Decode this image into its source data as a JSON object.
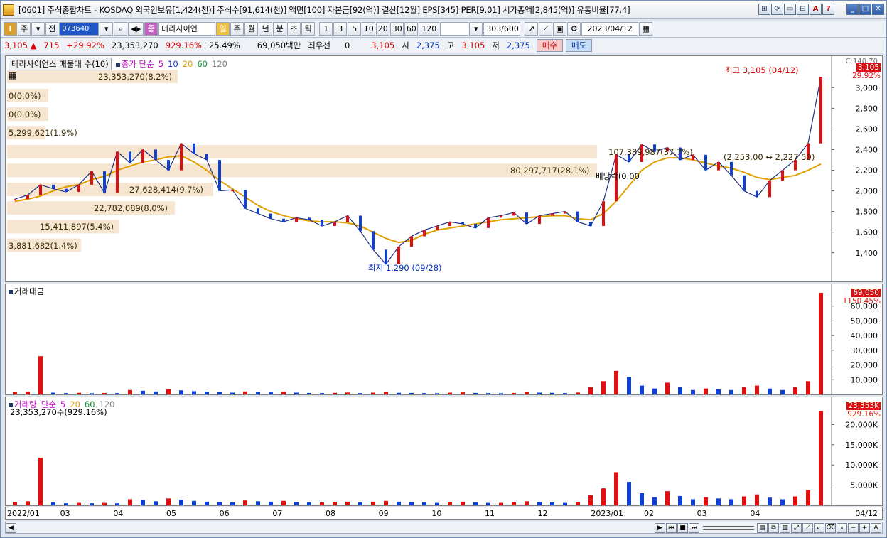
{
  "window": {
    "title": "[0601] 주식종합차트 - KOSDAQ 외국인보유[1,424(천)] 주식수[91,614(천)] 액면[100] 자본금[92(억)] 결산[12월] EPS[345] PER[9.01] 시가총액[2,845(억)] 유통비율[77.4]",
    "controls": [
      "⊞",
      "⟳",
      "▭",
      "⊟",
      "A",
      "?",
      "_",
      "□",
      "✕"
    ]
  },
  "toolbar": {
    "type_select": "주",
    "prev_label": "전",
    "stock_code": "073640",
    "stock_name": "테라사이언",
    "periods": [
      "일",
      "주",
      "월",
      "년",
      "분",
      "초",
      "틱"
    ],
    "active_period": "일",
    "intervals": [
      "1",
      "3",
      "5",
      "10",
      "20",
      "30",
      "60",
      "120"
    ],
    "page_display": "303/600",
    "date": "2023/04/12"
  },
  "quote": {
    "price": "3,105",
    "change": "715",
    "change_pct": "+29.92%",
    "volume": "23,353,270",
    "volume_pct": "929.16%",
    "turnover": "25.49%",
    "amount": "69,050백만",
    "pref_label": "최우선",
    "pref_value": "0",
    "ask": "3,105",
    "open_label": "시",
    "open": "2,375",
    "high_label": "고",
    "high": "3,105",
    "low_label": "저",
    "low": "2,375",
    "buy_label": "매수",
    "sell_label": "매도"
  },
  "price_panel": {
    "legend_box": "테라사이언스 매물대 수(10)",
    "ma_label": "종가 단순",
    "ma_periods": [
      "5",
      "10",
      "20",
      "60",
      "120"
    ],
    "ma_colors": [
      "#c000c0",
      "#1030c0",
      "#e0a000",
      "#109030",
      "#808080"
    ],
    "high_note": "최고 3,105 (04/12)",
    "low_note": "최저 1,290 (09/28)",
    "dividend_note": "배당락(0.00",
    "axis_top": "C:140.70",
    "last_tag": "3,105",
    "last_pct": "29.92%",
    "bands": [
      {
        "label": "23,353,270(8.2%)",
        "price": 3105
      },
      {
        "label": "0(0.0%)",
        "price": 2920
      },
      {
        "label": "0(0.0%)",
        "price": 2740
      },
      {
        "label": "5,299,621(1.9%)",
        "price": 2560
      },
      {
        "label": "107,389,987(37.7%)",
        "price": 2375
      },
      {
        "label": "80,297,717(28.1%)",
        "price": 2195
      },
      {
        "label": "27,628,414(9.7%)",
        "price": 2010
      },
      {
        "label": "22,782,089(8.0%)",
        "price": 1830
      },
      {
        "label": "15,411,897(5.4%)",
        "price": 1650
      },
      {
        "label": "3,881,682(1.4%)",
        "price": 1470
      }
    ],
    "cursor_note": "(2,253.00 ↔ 2,227.50)"
  },
  "amount_panel": {
    "title": "거래대금",
    "last_tag": "69,050",
    "last_pct": "1150.45%"
  },
  "volume_panel": {
    "title": "거래량",
    "ma_label": "단순",
    "ma_periods": [
      "5",
      "20",
      "60",
      "120"
    ],
    "ma_colors": [
      "#c000c0",
      "#e0a000",
      "#109030",
      "#808080"
    ],
    "last_value": "23,353,270주(929.16%)",
    "last_tag": "23,353K",
    "last_pct": "929.16%"
  },
  "xaxis": {
    "labels": [
      "2022/01",
      "03",
      "04",
      "05",
      "06",
      "07",
      "08",
      "09",
      "10",
      "11",
      "12",
      "2023/01",
      "02",
      "03",
      "04"
    ],
    "right_label": "04/12"
  },
  "chart_data": [
    {
      "type": "line",
      "name": "price",
      "ylim": [
        1240,
        3250
      ],
      "yticks": [
        1400,
        1600,
        1800,
        2000,
        2200,
        2400,
        2600,
        2800,
        3000
      ],
      "x": [
        "2022/01",
        "03",
        "04",
        "05",
        "06",
        "07",
        "08",
        "09",
        "10",
        "11",
        "12",
        "2023/01",
        "02",
        "03",
        "04"
      ],
      "close_path": [
        1920,
        1960,
        2060,
        2020,
        1990,
        2060,
        2190,
        1980,
        2380,
        2270,
        2400,
        2300,
        2200,
        2460,
        2360,
        2300,
        2000,
        2010,
        1830,
        1780,
        1730,
        1700,
        1740,
        1720,
        1660,
        1700,
        1760,
        1610,
        1430,
        1290,
        1460,
        1560,
        1620,
        1660,
        1700,
        1680,
        1640,
        1740,
        1760,
        1790,
        1680,
        1760,
        1780,
        1800,
        1700,
        1660,
        1900,
        2350,
        2280,
        2450,
        2380,
        2420,
        2300,
        2350,
        2200,
        2280,
        2150,
        2000,
        1940,
        2100,
        2200,
        2300,
        2460,
        3105
      ],
      "ma_period": "20",
      "ma_values": [
        1900,
        1920,
        1950,
        2000,
        2040,
        2060,
        2110,
        2140,
        2200,
        2240,
        2280,
        2300,
        2330,
        2340,
        2280,
        2200,
        2100,
        2020,
        1940,
        1860,
        1800,
        1760,
        1730,
        1710,
        1700,
        1700,
        1690,
        1660,
        1600,
        1540,
        1500,
        1520,
        1580,
        1620,
        1640,
        1660,
        1680,
        1700,
        1720,
        1730,
        1740,
        1750,
        1760,
        1760,
        1730,
        1720,
        1780,
        1900,
        2050,
        2200,
        2280,
        2320,
        2320,
        2300,
        2270,
        2240,
        2220,
        2180,
        2130,
        2110,
        2130,
        2150,
        2200,
        2260
      ]
    },
    {
      "type": "bar",
      "name": "amount",
      "ylim": [
        0,
        70000
      ],
      "yticks": [
        10000,
        20000,
        30000,
        40000,
        50000,
        60000
      ],
      "values": [
        1500,
        1800,
        26000,
        1200,
        900,
        1100,
        800,
        1000,
        900,
        3000,
        2500,
        2000,
        3500,
        2800,
        2200,
        1800,
        1500,
        1200,
        2000,
        1600,
        1400,
        1800,
        1200,
        1000,
        900,
        1100,
        1300,
        900,
        1200,
        1500,
        1100,
        1000,
        900,
        800,
        1200,
        1400,
        1000,
        900,
        800,
        1000,
        1500,
        1200,
        1100,
        900,
        1300,
        5000,
        9000,
        16000,
        12000,
        6000,
        4000,
        8000,
        5000,
        3000,
        4000,
        3500,
        3000,
        5000,
        6000,
        4000,
        3000,
        5000,
        9000,
        69050
      ]
    },
    {
      "type": "bar",
      "name": "volume",
      "ylim": [
        0,
        25000
      ],
      "yticks": [
        5000,
        10000,
        15000,
        20000
      ],
      "values": [
        800,
        1000,
        11800,
        700,
        500,
        600,
        500,
        600,
        500,
        1500,
        1300,
        1000,
        1700,
        1400,
        1100,
        900,
        800,
        700,
        1200,
        1000,
        900,
        1100,
        800,
        700,
        700,
        800,
        900,
        700,
        900,
        1100,
        900,
        800,
        700,
        600,
        800,
        900,
        700,
        600,
        600,
        700,
        1000,
        800,
        700,
        600,
        800,
        2500,
        4200,
        8200,
        5800,
        3000,
        2000,
        3500,
        2300,
        1500,
        2000,
        1700,
        1500,
        2200,
        2700,
        1900,
        1500,
        2200,
        3800,
        23353
      ]
    }
  ]
}
